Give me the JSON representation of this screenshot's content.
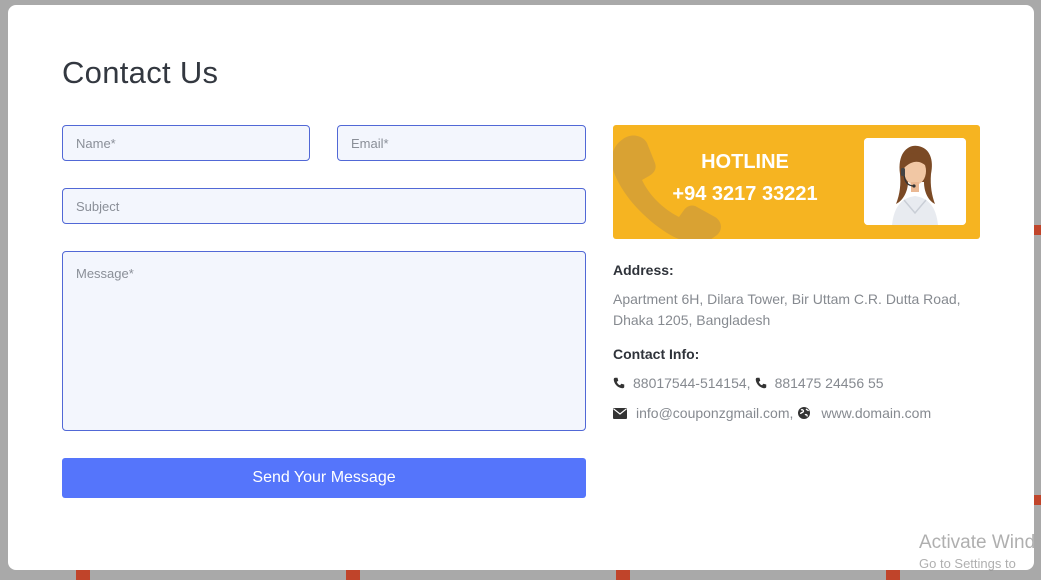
{
  "title": "Contact Us",
  "form": {
    "name_placeholder": "Name*",
    "email_placeholder": "Email*",
    "subject_placeholder": "Subject",
    "message_placeholder": "Message*",
    "submit_label": "Send Your Message"
  },
  "hotline": {
    "title": "HOTLINE",
    "number": "+94 3217 33221"
  },
  "address": {
    "label": "Address:",
    "text": "Apartment 6H, Dilara Tower, Bir Uttam C.R. Dutta Road, Dhaka 1205, Bangladesh"
  },
  "contact_info": {
    "label": "Contact Info:",
    "phone_1": "88017544-514154,",
    "phone_2": "881475 24456 55",
    "email": "info@couponzgmail.com,",
    "website": "www.domain.com"
  },
  "os_watermark": {
    "line1": "Activate Wind",
    "line2": "Go to Settings to"
  },
  "colors": {
    "accent_button": "#5575fb",
    "hotline_bg": "#f6b421",
    "input_border": "#5168d6",
    "input_bg": "#f3f6fd"
  },
  "icons": [
    "phone-icon",
    "envelope-icon",
    "globe-icon",
    "phone-watermark-icon"
  ]
}
